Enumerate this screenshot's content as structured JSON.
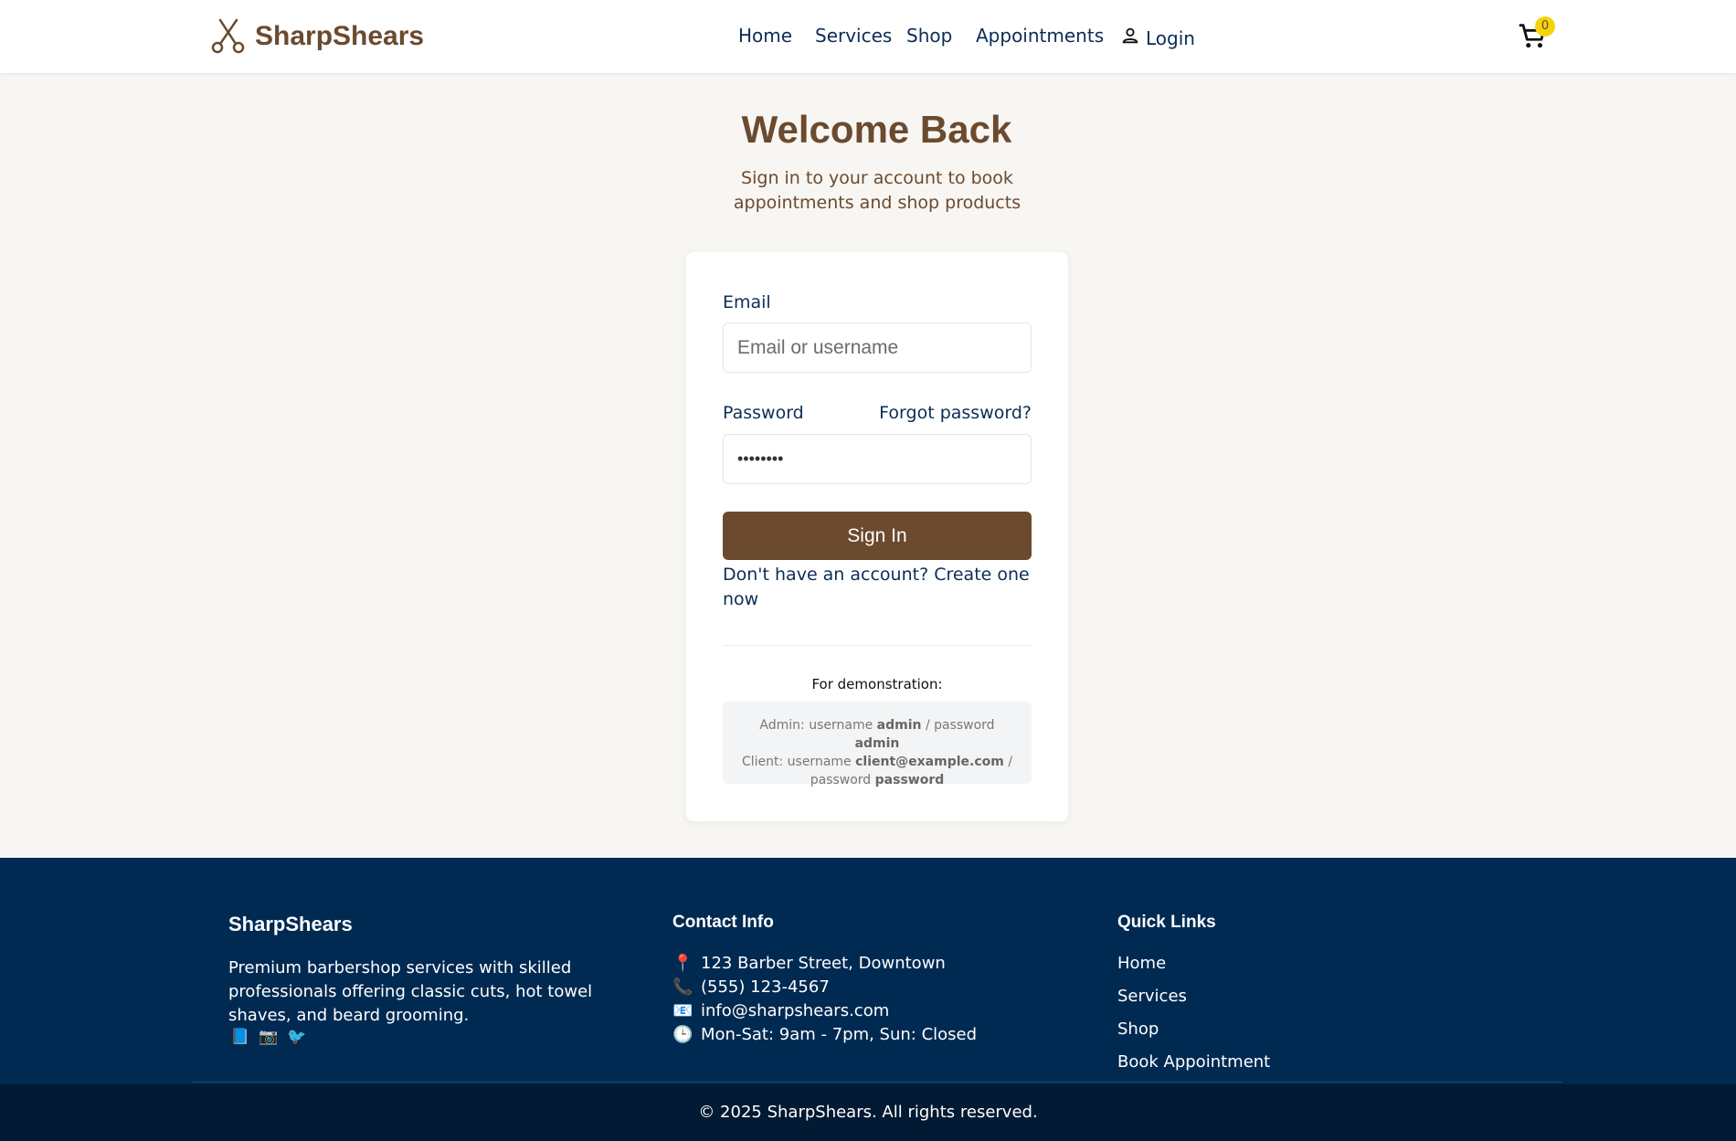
{
  "brand": {
    "name": "SharpShears",
    "logo_icon": "scissors-icon",
    "color": "#6b4a2e"
  },
  "nav": {
    "items": [
      {
        "label": "Home"
      },
      {
        "label": "Services"
      },
      {
        "label": "Shop"
      },
      {
        "label": "Appointments"
      }
    ],
    "login_label": "Login",
    "login_icon": "person-icon",
    "cart_icon": "cart-icon",
    "cart_count": "0"
  },
  "hero": {
    "title": "Welcome Back",
    "subtitle": "Sign in to your account to book appointments and shop products"
  },
  "form": {
    "email_label": "Email",
    "email_placeholder": "Email or username",
    "email_value": "",
    "password_label": "Password",
    "password_value": "••••••••",
    "forgot_label": "Forgot password?",
    "submit_label": "Sign In",
    "signup_label": "Don't have an account? Create one now"
  },
  "demo": {
    "title": "For demonstration:",
    "admin_prefix": "Admin: username",
    "admin_username": "admin",
    "admin_sep": "/ password",
    "admin_password": "admin",
    "client_prefix": "Client: username",
    "client_username": "client@example.com",
    "client_sep": "/ password",
    "client_password": "password"
  },
  "footer": {
    "brand": "SharpShears",
    "description": "Premium barbershop services with skilled professionals offering classic cuts, hot towel shaves, and beard grooming.",
    "socials": [
      {
        "icon": "facebook-icon",
        "glyph": "📘"
      },
      {
        "icon": "camera-icon",
        "glyph": "📷"
      },
      {
        "icon": "bird-icon",
        "glyph": "🐦"
      }
    ],
    "contact_title": "Contact Info",
    "contact": [
      {
        "icon": "pin-icon",
        "glyph": "📍",
        "text": "123 Barber Street, Downtown"
      },
      {
        "icon": "phone-icon",
        "glyph": "📞",
        "text": "(555) 123-4567"
      },
      {
        "icon": "email-icon",
        "glyph": "📧",
        "text": "info@sharpshears.com"
      },
      {
        "icon": "clock-icon",
        "glyph": "🕒",
        "text": "Mon-Sat: 9am - 7pm, Sun: Closed"
      }
    ],
    "links_title": "Quick Links",
    "links": [
      "Home",
      "Services",
      "Shop",
      "Book Appointment"
    ],
    "copyright": "© 2025 SharpShears. All rights reserved."
  },
  "colors": {
    "primary": "#6b4a2e",
    "navy": "#0c2d57",
    "footer_bg": "#002a52",
    "bottom_bg": "#021a33",
    "badge": "#f5d30e",
    "page_bg": "#f8f6f2"
  }
}
